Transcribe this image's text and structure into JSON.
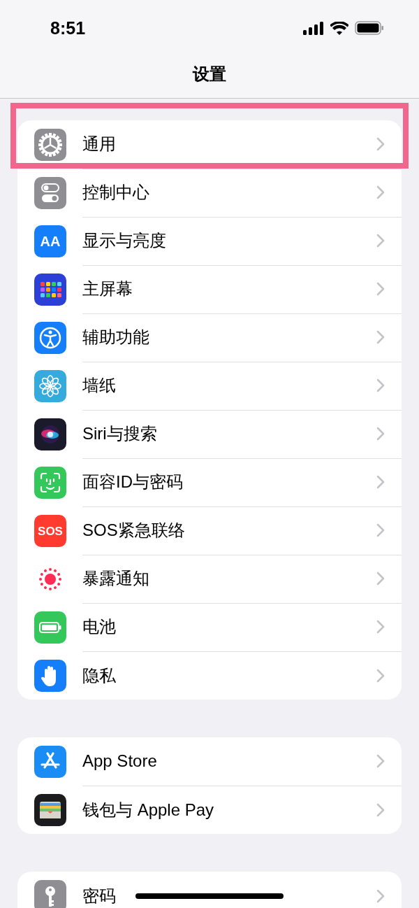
{
  "status_bar": {
    "time": "8:51"
  },
  "nav": {
    "title": "设置"
  },
  "groups": [
    {
      "items": [
        {
          "label": "通用",
          "kind": "gear",
          "color": "#8e8e93",
          "highlighted": true
        },
        {
          "label": "控制中心",
          "kind": "toggles",
          "color": "#8e8e93",
          "highlighted": false
        },
        {
          "label": "显示与亮度",
          "kind": "letters",
          "icon_text": "AA",
          "color": "#147efb",
          "highlighted": false
        },
        {
          "label": "主屏幕",
          "kind": "grid",
          "color": "#2c3fd6",
          "highlighted": false
        },
        {
          "label": "辅助功能",
          "kind": "accessibility",
          "color": "#147efb",
          "highlighted": false
        },
        {
          "label": "墙纸",
          "kind": "flower",
          "color": "#35aadc",
          "highlighted": false
        },
        {
          "label": "Siri与搜索",
          "kind": "siri",
          "color": "#1a1a2a",
          "highlighted": false
        },
        {
          "label": "面容ID与密码",
          "kind": "face",
          "color": "#34c759",
          "highlighted": false
        },
        {
          "label": "SOS紧急联络",
          "kind": "letters",
          "icon_text": "SOS",
          "color": "#ff3b30",
          "highlighted": false
        },
        {
          "label": "暴露通知",
          "kind": "exposure",
          "color": "#ffffff",
          "highlighted": false
        },
        {
          "label": "电池",
          "kind": "battery",
          "color": "#34c759",
          "highlighted": false
        },
        {
          "label": "隐私",
          "kind": "hand",
          "color": "#147efb",
          "highlighted": false
        }
      ]
    },
    {
      "items": [
        {
          "label": "App Store",
          "kind": "appstore",
          "color": "#1a8cf5",
          "highlighted": false
        },
        {
          "label": "钱包与 Apple Pay",
          "kind": "wallet",
          "color": "#1c1c1e",
          "highlighted": false
        }
      ]
    },
    {
      "items": [
        {
          "label": "密码",
          "kind": "key",
          "color": "#8e8e93",
          "highlighted": false
        }
      ]
    }
  ]
}
